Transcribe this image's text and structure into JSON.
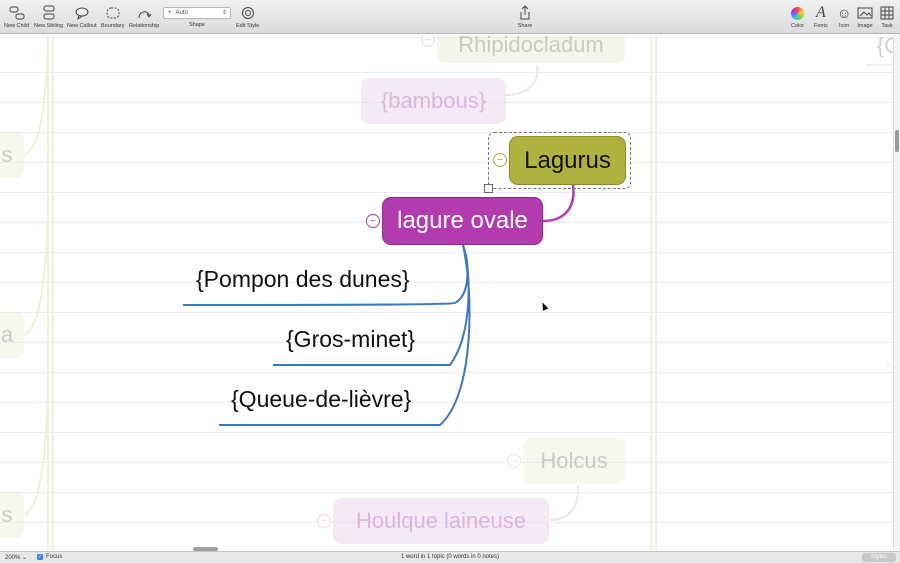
{
  "toolbar": {
    "new_child": "New Child",
    "new_sibling": "New Sibling",
    "new_callout": "New Callout",
    "boundary": "Boundary",
    "relationship": "Relationship",
    "shape_label": "Shape",
    "shape_value": "Auto",
    "edit_style": "Edit Style",
    "share": "Share",
    "color": "Color",
    "fonts": "Fonts",
    "icon": "Icon",
    "image": "Image",
    "task": "Task"
  },
  "map": {
    "central_topic": "lagure ovale",
    "parent_topic": "Lagurus",
    "subtopics": [
      "{Pompon des dunes}",
      "{Gros-minet}",
      "{Queue-de-lièvre}"
    ],
    "faded_topics": [
      "Rhipidocladum",
      "{bambous}",
      "Holcus",
      "Houlque laineuse"
    ],
    "faded_fragments": [
      "s",
      "a",
      "s",
      "{G"
    ]
  },
  "colors": {
    "central_topic": "#b23bb0",
    "parent_topic": "#b0b23f",
    "branch_line": "#3d78b8"
  },
  "statusbar": {
    "zoom": "200%",
    "focus": "Focus",
    "word_count": "1 word in 1 topic (0 words in 0 notes)",
    "styles": "Styles"
  }
}
